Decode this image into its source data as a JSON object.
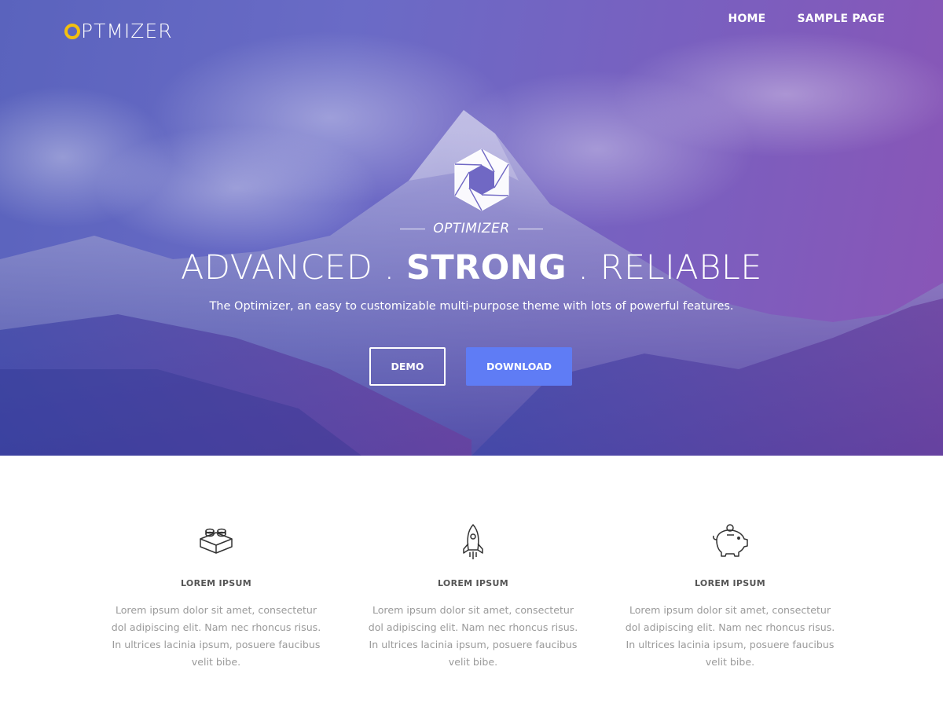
{
  "header": {
    "logo_text": "PTMIZER",
    "logo_ring_color": "#f3c010",
    "nav": [
      {
        "label": "HOME"
      },
      {
        "label": "SAMPLE PAGE"
      }
    ]
  },
  "hero": {
    "brand_name": "OPTIMIZER",
    "headline_part1": "ADVANCED . ",
    "headline_strong": "STRONG",
    "headline_part2": " . RELIABLE",
    "tagline": "The Optimizer, an easy to customizable multi-purpose theme with lots of powerful features.",
    "buttons": {
      "demo_label": "DEMO",
      "download_label": "DOWNLOAD"
    },
    "colors": {
      "overlay_left": "#5a63bd",
      "overlay_right": "#8a55b6",
      "download_button": "#5f7cf5"
    }
  },
  "features": [
    {
      "icon": "lego-brick-icon",
      "title": "LOREM IPSUM",
      "text": "Lorem ipsum dolor sit amet, consectetur dol adipiscing elit. Nam nec rhoncus risus. In ultrices lacinia ipsum, posuere faucibus velit bibe."
    },
    {
      "icon": "rocket-icon",
      "title": "LOREM IPSUM",
      "text": "Lorem ipsum dolor sit amet, consectetur dol adipiscing elit. Nam nec rhoncus risus. In ultrices lacinia ipsum, posuere faucibus velit bibe."
    },
    {
      "icon": "piggy-bank-icon",
      "title": "LOREM IPSUM",
      "text": "Lorem ipsum dolor sit amet, consectetur dol adipiscing elit. Nam nec rhoncus risus. In ultrices lacinia ipsum, posuere faucibus velit bibe."
    }
  ]
}
